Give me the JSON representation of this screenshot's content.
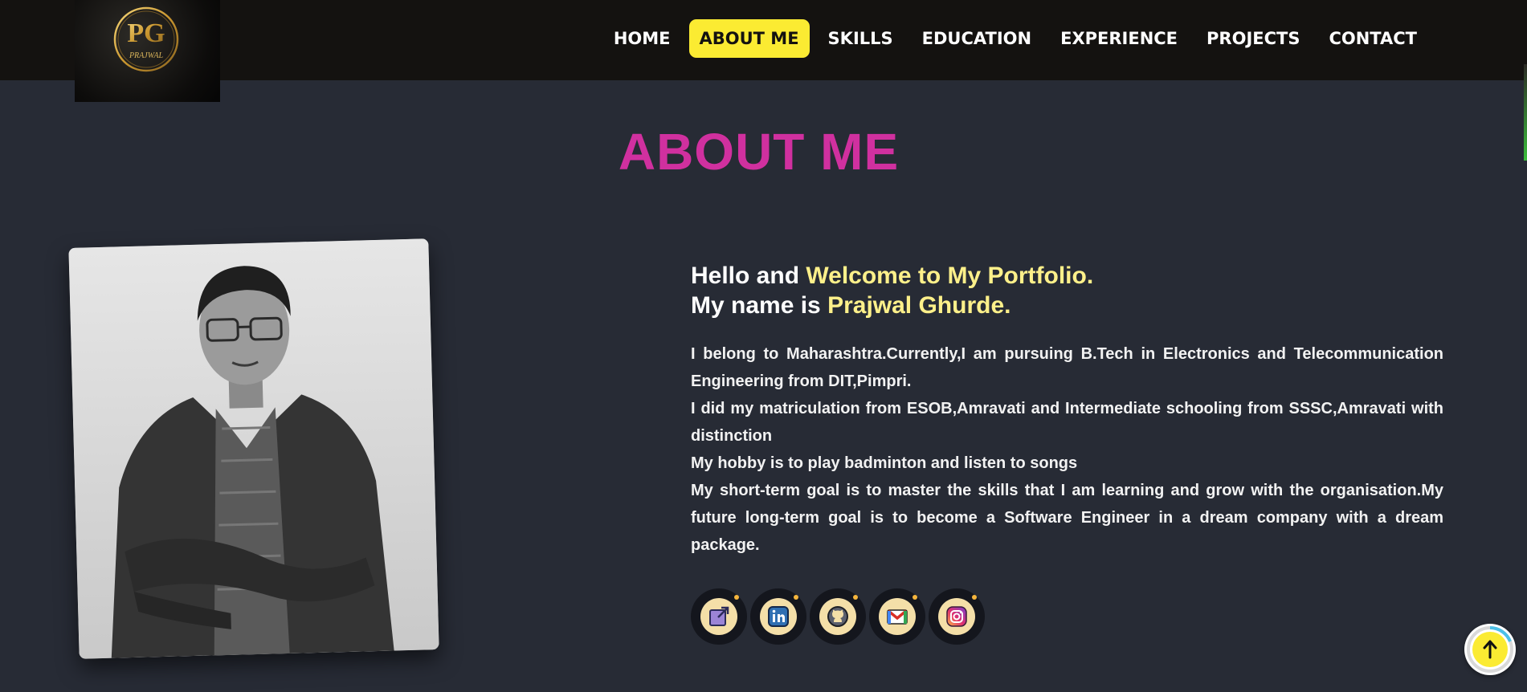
{
  "logo": {
    "monogram": "PG",
    "name": "PRAJWAL"
  },
  "nav": {
    "items": [
      {
        "label": "HOME"
      },
      {
        "label": "ABOUT ME",
        "active": true
      },
      {
        "label": "SKILLS"
      },
      {
        "label": "EDUCATION"
      },
      {
        "label": "EXPERIENCE"
      },
      {
        "label": "PROJECTS"
      },
      {
        "label": "CONTACT"
      }
    ]
  },
  "about": {
    "title": "ABOUT ME",
    "greeting": {
      "line1_plain": "Hello and ",
      "line1_highlight": "Welcome to My Portfolio.",
      "line2_plain": "My name is ",
      "line2_highlight": "Prajwal Ghurde."
    },
    "paragraphs": [
      "I belong to Maharashtra.Currently,I am pursuing B.Tech in Electronics and Telecommunication Engineering from DIT,Pimpri.",
      "I did my matriculation from ESOB,Amravati and Intermediate schooling from SSSC,Amravati with distinction",
      "My hobby is to play badminton and listen to songs",
      "My short-term goal is to master the skills that I am learning and grow with the organisation.My future long-term goal is to become a Software Engineer in a dream company with a dream package."
    ]
  },
  "social": [
    {
      "icon": "external-link-icon"
    },
    {
      "icon": "linkedin-icon"
    },
    {
      "icon": "github-icon"
    },
    {
      "icon": "gmail-icon"
    },
    {
      "icon": "instagram-icon"
    }
  ],
  "colors": {
    "navbar_bg": "#141210",
    "page_bg": "#272b35",
    "accent_yellow": "#fbeb32",
    "title_magenta": "#d0309f",
    "highlight_text": "#fdf08a"
  },
  "back_to_top": {
    "icon": "arrow-up-icon"
  }
}
